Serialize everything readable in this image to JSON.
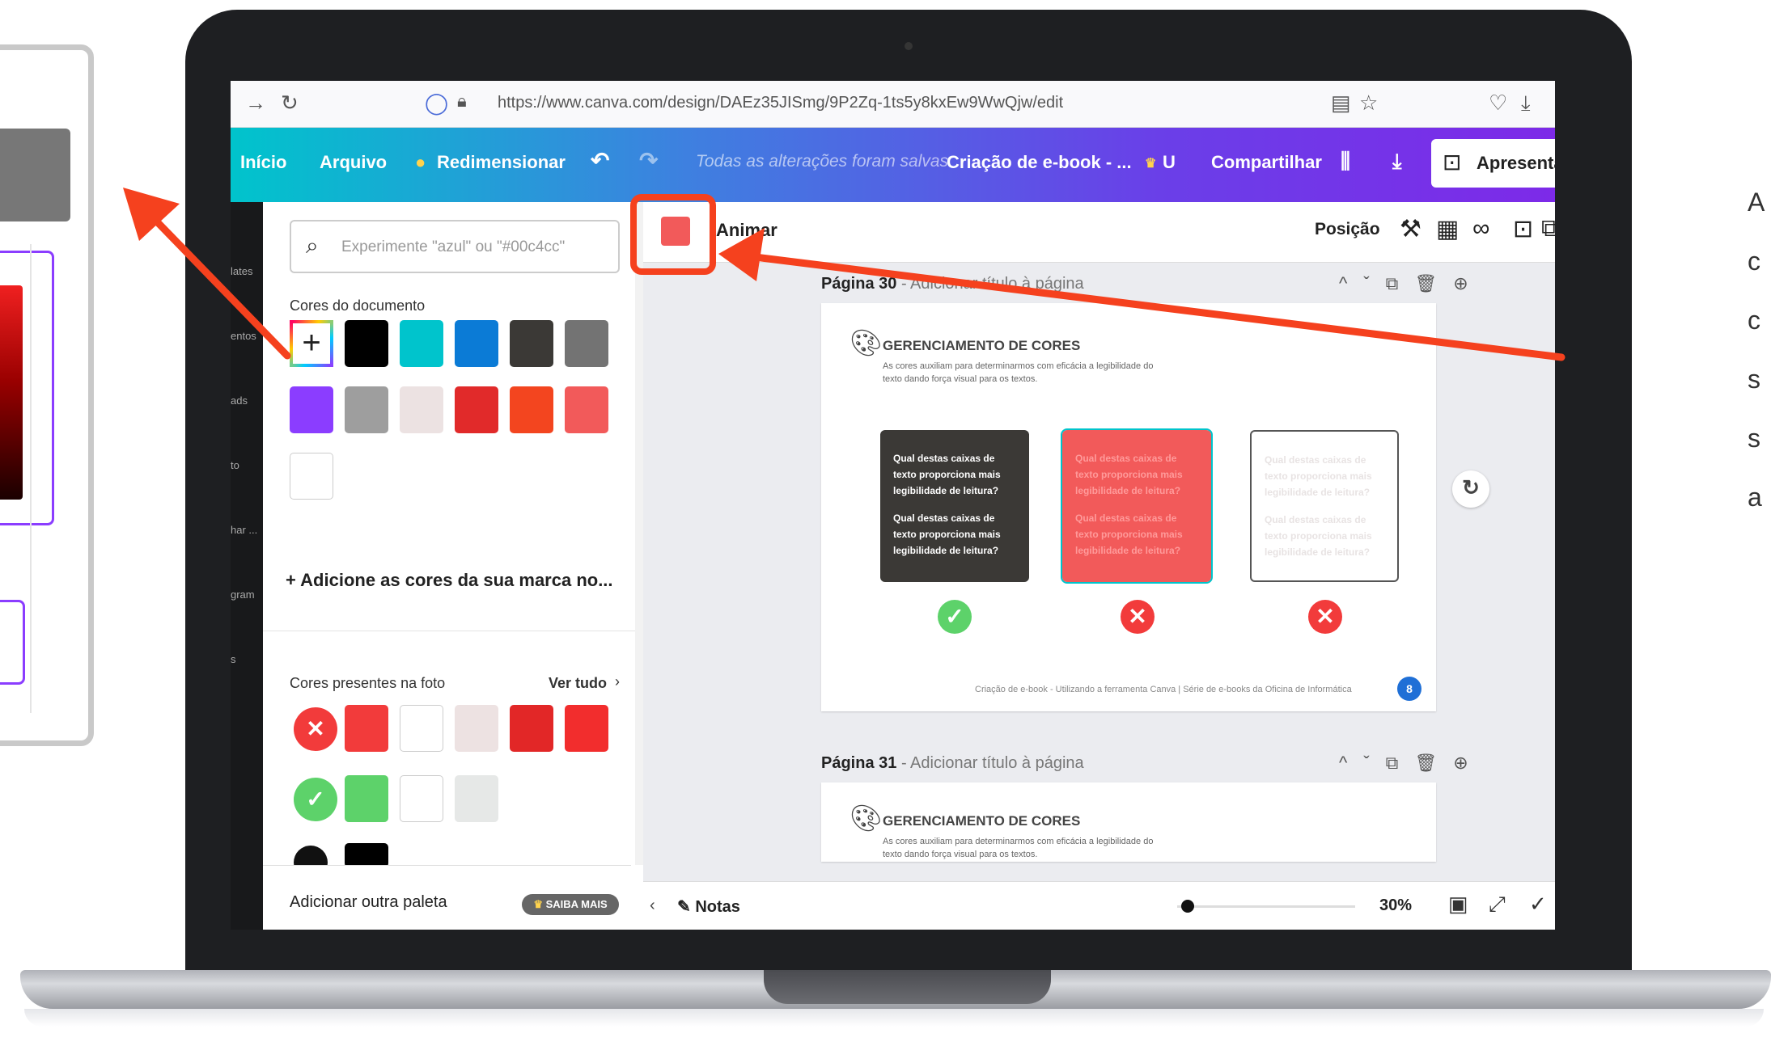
{
  "colors": {
    "accent": "#8b3dff",
    "highlight": "#f5411e",
    "teal": "#00c4cc",
    "coral": "#f25a5a"
  },
  "browser": {
    "url": "https://www.canva.com/design/DAEz35JISmg/9P2Zq-1ts5y8kxEw9WwQjw/edit"
  },
  "toolbar": {
    "inicio": "Início",
    "arquivo": "Arquivo",
    "redimensionar": "Redimensionar",
    "saved": "Todas as alterações foram salvas",
    "doc_title": "Criação de e-book - ...",
    "user": "U",
    "compartilhar": "Compartilhar",
    "apresentar": "Apresentar"
  },
  "rail": [
    "lates",
    "entos",
    "ads",
    "to",
    "har ...",
    "gram",
    "s"
  ],
  "color_panel": {
    "search_placeholder": "Experimente \"azul\" ou \"#00c4cc\"",
    "doc_colors_label": "Cores do documento",
    "doc_colors": [
      "#000000",
      "#00c4cc",
      "#0b7bd6",
      "#3b3936",
      "#737373",
      "#8b3dff",
      "#9e9e9e",
      "#ece2e2",
      "#e12a2a",
      "#f3451f",
      "#f25a5a",
      "#ffffff"
    ],
    "add_brand": "Adicione as cores da sua marca no...",
    "photo_label": "Cores presentes na foto",
    "see_all": "Ver tudo",
    "photo_colors_row1": [
      "#f23b3b",
      "#ffffff",
      "#ede2e2",
      "#e22727",
      "#f22d2d"
    ],
    "photo_colors_row2": [
      "#5dd26a",
      "#ffffff",
      "#e6e8e7"
    ],
    "add_palette": "Adicionar outra paleta",
    "saiba": "SAIBA MAIS"
  },
  "canvas": {
    "animar": "Animar",
    "posicao": "Posição",
    "page30_num": "Página 30",
    "page30_title": " - Adicionar título à página",
    "page31_num": "Página 31",
    "page31_title": " - Adicionar título à página",
    "heading": "GERENCIAMENTO DE CORES",
    "subtitle": "As cores auxiliam para determinarmos com eficácia a legibilidade do texto dando força visual para os textos.",
    "question": "Qual destas caixas de texto proporciona mais legibilidade de leitura?",
    "footer": "Criação de e-book - Utilizando a ferramenta Canva  |  Série de e-books da Oficina de Informática",
    "page_badge": "8",
    "notas": "Notas",
    "zoom": "30%"
  },
  "right_text": [
    "A",
    "c",
    "c",
    "s",
    "s",
    "a"
  ]
}
